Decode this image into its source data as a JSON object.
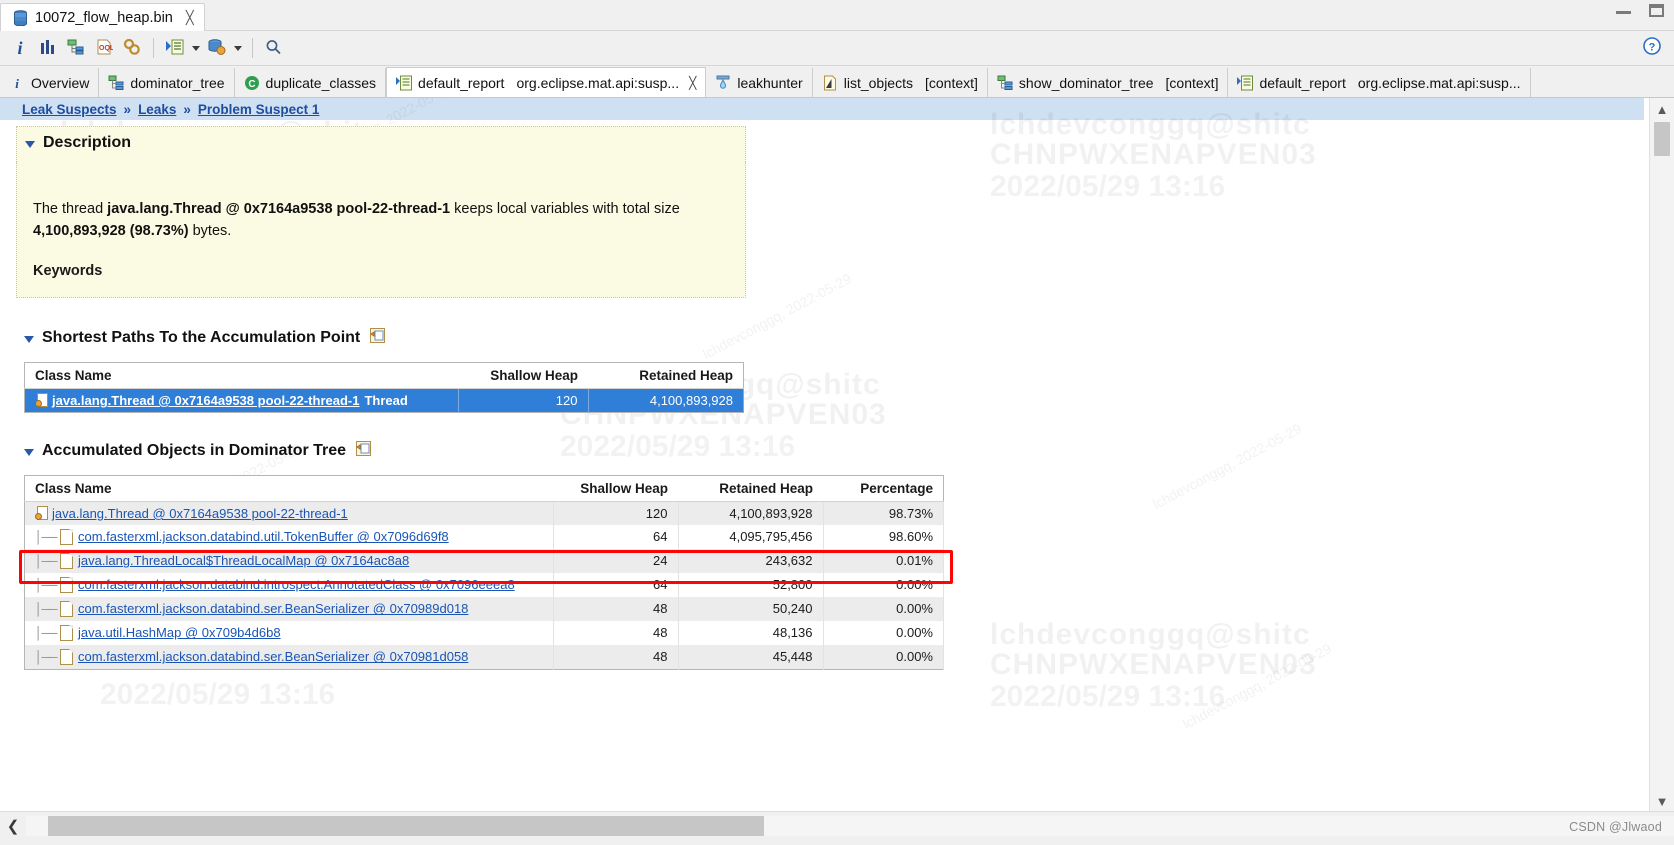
{
  "window": {
    "file_tab_label": "10072_flow_heap.bin",
    "file_tab_icon": "heap-dump-icon",
    "close_glyph": "╳",
    "minimize_label": "minimize",
    "maximize_label": "maximize"
  },
  "toolbar": {
    "items": [
      {
        "name": "overview-info-button",
        "glyph": "i",
        "title": "Overview"
      },
      {
        "name": "histogram-button",
        "glyph": "bars",
        "title": "Histogram"
      },
      {
        "name": "dominator-tree-button",
        "glyph": "tree",
        "title": "Dominator Tree"
      },
      {
        "name": "oql-button",
        "glyph": "OQL",
        "title": "OQL Studio"
      },
      {
        "name": "calculate-retained-size-button",
        "glyph": "gears",
        "title": "Calculate Retained Size"
      },
      {
        "name": "run-expert-system-test-button",
        "glyph": "play-list",
        "title": "Run Expert System Test"
      },
      {
        "name": "query-browser-button",
        "glyph": "db-gear",
        "title": "Query Browser"
      },
      {
        "name": "search-button",
        "glyph": "magnifier",
        "title": "Find"
      }
    ],
    "help_icon": "help-icon"
  },
  "view_tabs": [
    {
      "label": "Overview",
      "icon": "info-icon",
      "active": false,
      "closable": false,
      "context": ""
    },
    {
      "label": "dominator_tree",
      "icon": "tree-icon",
      "active": false,
      "closable": false,
      "context": ""
    },
    {
      "label": "duplicate_classes",
      "icon": "copy-icon",
      "active": false,
      "closable": false,
      "context": ""
    },
    {
      "label": "default_report",
      "icon": "report-icon",
      "active": true,
      "closable": true,
      "context": "org.eclipse.mat.api:susp..."
    },
    {
      "label": "leakhunter",
      "icon": "leakhunter-icon",
      "active": false,
      "closable": false,
      "context": ""
    },
    {
      "label": "list_objects",
      "icon": "list-icon",
      "active": false,
      "closable": false,
      "context": "[context]"
    },
    {
      "label": "show_dominator_tree",
      "icon": "tree-icon",
      "active": false,
      "closable": false,
      "context": "[context]"
    },
    {
      "label": "default_report",
      "icon": "report-icon",
      "active": false,
      "closable": false,
      "context": "org.eclipse.mat.api:susp..."
    }
  ],
  "breadcrumb": {
    "items": [
      "Leak Suspects",
      "Leaks",
      "Problem Suspect 1"
    ],
    "separator": "»"
  },
  "description": {
    "title": "Description",
    "text_prefix": "The thread ",
    "thread_name": "java.lang.Thread @ 0x7164a9538 pool-22-thread-1",
    "text_middle": " keeps local variables with total size ",
    "total_size": "4,100,893,928 (98.73%)",
    "text_suffix": " bytes.",
    "keywords_title": "Keywords"
  },
  "shortest_paths": {
    "title": "Shortest Paths To the Accumulation Point",
    "link_icon": "open-query-icon",
    "columns": [
      "Class Name",
      "Shallow Heap",
      "Retained Heap"
    ],
    "rows": [
      {
        "class_name": "java.lang.Thread @ 0x7164a9538 pool-22-thread-1",
        "suffix": "Thread",
        "shallow_heap": "120",
        "retained_heap": "4,100,893,928",
        "selected": true
      }
    ]
  },
  "accumulated_objects": {
    "title": "Accumulated Objects in Dominator Tree",
    "link_icon": "open-query-icon",
    "columns": [
      "Class Name",
      "Shallow Heap",
      "Retained Heap",
      "Percentage"
    ],
    "rows": [
      {
        "class_name": "java.lang.Thread @ 0x7164a9538 pool-22-thread-1",
        "shallow_heap": "120",
        "retained_heap": "4,100,893,928",
        "percentage": "98.73%",
        "depth": 0,
        "icon": "thread-icon"
      },
      {
        "class_name": "com.fasterxml.jackson.databind.util.TokenBuffer @ 0x7096d69f8",
        "shallow_heap": "64",
        "retained_heap": "4,095,795,456",
        "percentage": "98.60%",
        "depth": 1,
        "icon": "object-icon"
      },
      {
        "class_name": "java.lang.ThreadLocal$ThreadLocalMap @ 0x7164ac8a8",
        "shallow_heap": "24",
        "retained_heap": "243,632",
        "percentage": "0.01%",
        "depth": 1,
        "icon": "object-icon"
      },
      {
        "class_name": "com.fasterxml.jackson.databind.introspect.AnnotatedClass @ 0x7096eeea8",
        "shallow_heap": "64",
        "retained_heap": "52,800",
        "percentage": "0.00%",
        "depth": 1,
        "icon": "object-icon"
      },
      {
        "class_name": "com.fasterxml.jackson.databind.ser.BeanSerializer @ 0x70989d018",
        "shallow_heap": "48",
        "retained_heap": "50,240",
        "percentage": "0.00%",
        "depth": 1,
        "icon": "object-icon"
      },
      {
        "class_name": "java.util.HashMap @ 0x709b4d6b8",
        "shallow_heap": "48",
        "retained_heap": "48,136",
        "percentage": "0.00%",
        "depth": 1,
        "icon": "object-icon"
      },
      {
        "class_name": "com.fasterxml.jackson.databind.ser.BeanSerializer @ 0x70981d058",
        "shallow_heap": "48",
        "retained_heap": "45,448",
        "percentage": "0.00%",
        "depth": 1,
        "icon": "object-icon"
      }
    ],
    "highlight_color": "#fb0505"
  },
  "status_bar": {
    "watermark": "CSDN @Jlwaod"
  },
  "watermarks": {
    "user": "lchdevconggq@shitc",
    "code": "CHNPWXENAPVEN03",
    "date": "2022/05/29 13:16",
    "diagonal": "lchdevconggq, 2022-05-29"
  }
}
